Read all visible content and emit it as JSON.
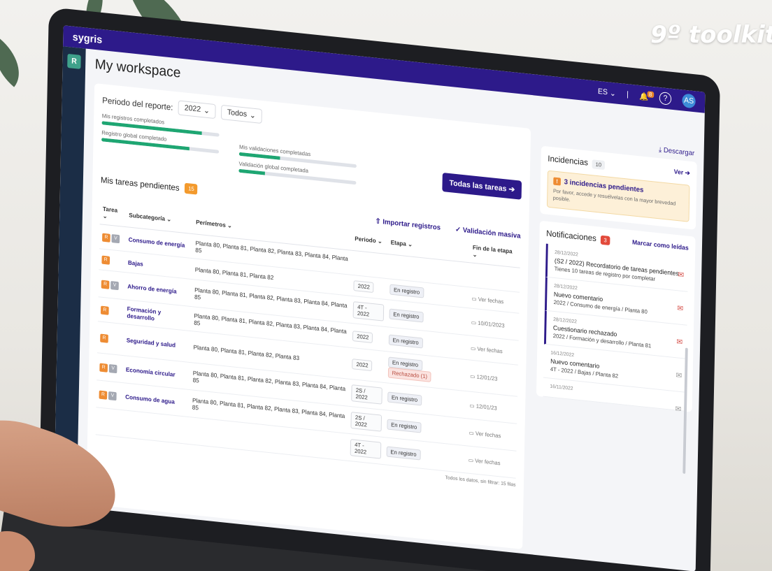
{
  "promo": {
    "title": "9º toolkit"
  },
  "app": {
    "brand": "sygris",
    "page_title": "My workspace",
    "sidebar_initial": "R"
  },
  "topbar": {
    "language": "ES",
    "notif_count": "8",
    "user_initials": "AS"
  },
  "report": {
    "period_label": "Periodo del reporte:",
    "year": "2022",
    "scope": "Todos",
    "progress": [
      {
        "label": "Mis registros completados",
        "value": 0.85
      },
      {
        "label": "Registro global completado",
        "value": 0.75
      },
      {
        "label": "Mis validaciones completadas",
        "value": 0.35
      },
      {
        "label": "Validación global completada",
        "value": 0.22
      }
    ],
    "all_tasks_button": "Todas las tareas"
  },
  "tasks": {
    "title": "Mis tareas pendientes",
    "count": "15",
    "import_label": "Importar registros",
    "mass_validation_label": "Validación masiva",
    "headers": [
      "Tarea",
      "Subcategoría",
      "Perímetros",
      "Periodo",
      "Etapa",
      "Fin de la etapa"
    ],
    "rows": [
      {
        "tags": [
          "R",
          "V"
        ],
        "name": "Consumo de energía",
        "perimeters": "Planta 80, Planta 81, Planta 82, Planta 83, Planta 84, Planta 85",
        "period": "",
        "stage": "",
        "rejected": "",
        "end": ""
      },
      {
        "tags": [
          "R"
        ],
        "name": "Bajas",
        "perimeters": "Planta 80, Planta 81, Planta 82",
        "period": "2022",
        "stage": "En registro",
        "rejected": "",
        "end": "Ver fechas"
      },
      {
        "tags": [
          "R",
          "V"
        ],
        "name": "Ahorro de energía",
        "perimeters": "Planta 80, Planta 81, Planta 82, Planta 83, Planta 84, Planta 85",
        "period": "4T - 2022",
        "stage": "En registro",
        "rejected": "",
        "end": "10/01/2023"
      },
      {
        "tags": [
          "R"
        ],
        "name": "Formación y desarrollo",
        "perimeters": "Planta 80, Planta 81, Planta 82, Planta 83, Planta 84, Planta 85",
        "period": "2022",
        "stage": "En registro",
        "rejected": "",
        "end": "Ver fechas"
      },
      {
        "tags": [
          "R"
        ],
        "name": "Seguridad y salud",
        "perimeters": "Planta 80, Planta 81, Planta 82, Planta 83",
        "period": "2022",
        "stage": "En registro",
        "rejected": "Rechazado (1)",
        "end": "12/01/23"
      },
      {
        "tags": [
          "R",
          "V"
        ],
        "name": "Economía circular",
        "perimeters": "Planta 80, Planta 81, Planta 82, Planta 83, Planta 84, Planta 85",
        "period": "2S / 2022",
        "stage": "En registro",
        "rejected": "",
        "end": "12/01/23"
      },
      {
        "tags": [
          "R",
          "V"
        ],
        "name": "Consumo de agua",
        "perimeters": "Planta 80, Planta 81, Planta 82, Planta 83, Planta 84, Planta 85",
        "period": "2S / 2022",
        "stage": "En registro",
        "rejected": "",
        "end": "Ver fechas"
      },
      {
        "tags": [],
        "name": "",
        "perimeters": "",
        "period": "4T - 2022",
        "stage": "En registro",
        "rejected": "",
        "end": "Ver fechas"
      }
    ],
    "footer": "Todos los datos, sin filtrar: 15 filas"
  },
  "right": {
    "download_label": "Descargar",
    "incidents": {
      "title": "Incidencias",
      "count": "10",
      "view_label": "Ver",
      "alert_title": "3 incidencias pendientes",
      "alert_text": "Por favor, accede y resuélvelas con la mayor brevedad posible."
    },
    "notifications": {
      "title": "Notificaciones",
      "count": "3",
      "mark_read": "Marcar como leídas",
      "items": [
        {
          "date": "28/12/2022",
          "title": "(S2 / 2022) Recordatorio de tareas pendientes",
          "body": "Tienes 10 tareas de registro por completar",
          "unread": true
        },
        {
          "date": "28/12/2022",
          "title": "Nuevo comentario",
          "body": "2022 / Consumo de energía / Planta 80",
          "unread": true
        },
        {
          "date": "28/12/2022",
          "title": "Cuestionario rechazado",
          "body": "2022 / Formación y desarrollo / Planta 81",
          "unread": true
        },
        {
          "date": "16/12/2022",
          "title": "Nuevo comentario",
          "body": "4T - 2022 / Bajas / Planta 82",
          "unread": false
        },
        {
          "date": "16/11/2022",
          "title": "",
          "body": "",
          "unread": false
        }
      ]
    }
  },
  "colors": {
    "brand": "#2d1a8a",
    "accent": "#f39a2d",
    "success": "#1ea672",
    "danger": "#e24a3b"
  }
}
